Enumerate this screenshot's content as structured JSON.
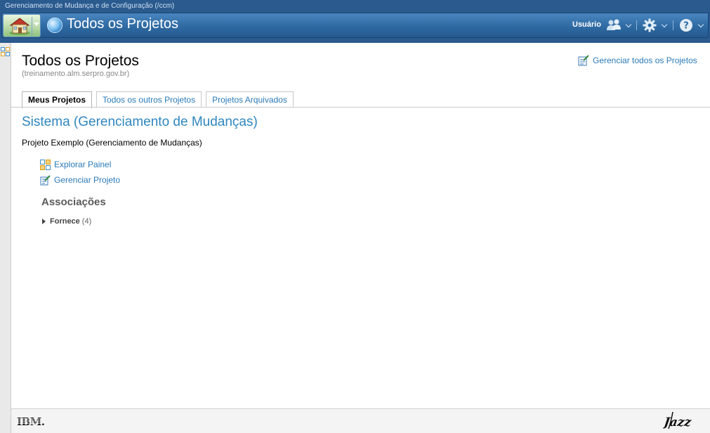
{
  "app": {
    "window_title": "Gerenciamento de Mudança e de Configuração (/ccm)",
    "page_heading": "Todos os Projetos",
    "user_label": "Usuário"
  },
  "icons": {
    "home": "home-icon",
    "globe": "globe-icon",
    "users": "users-icon",
    "settings": "gear-icon",
    "help": "help-icon",
    "dashboard": "dashboard-icon",
    "manage": "manage-project-icon"
  },
  "header": {
    "title": "Todos os Projetos",
    "server": "(treinamento.alm.serpro.gov.br)",
    "manage_all": "Gerenciar todos os Projetos"
  },
  "tabs": [
    {
      "label": "Meus Projetos",
      "active": true
    },
    {
      "label": "Todos os outros Projetos",
      "active": false
    },
    {
      "label": "Projetos Arquivados",
      "active": false
    }
  ],
  "section": {
    "title": "Sistema (Gerenciamento de Mudanças)",
    "project": "Projeto Exemplo (Gerenciamento de Mudanças)",
    "links": {
      "explore": "Explorar Painel",
      "manage": "Gerenciar Projeto"
    },
    "associations_title": "Associações",
    "associations": [
      {
        "name": "Fornece",
        "count": "(4)"
      }
    ]
  },
  "footer": {
    "left_logo": "IBM.",
    "right_logo": "Jazz"
  },
  "colors": {
    "appbar": "#2a5a8e",
    "link": "#2a7ab8",
    "section_title": "#2e86bf"
  }
}
